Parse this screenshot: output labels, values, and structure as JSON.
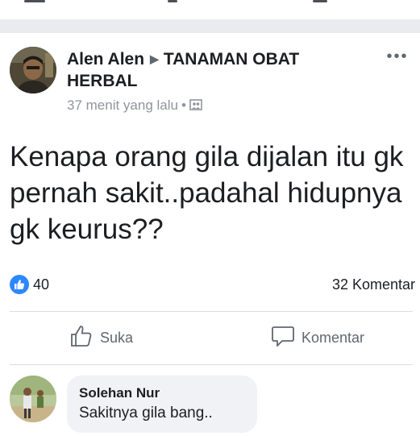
{
  "post": {
    "author": "Alen Alen",
    "group": "TANAMAN OBAT HERBAL",
    "time": "37 menit yang lalu",
    "separator": "•",
    "privacy_icon": "group-icon",
    "more_label": "•••",
    "text": "Kenapa orang gila dijalan itu gk pernah sakit..padahal hidupnya gk keurus??"
  },
  "reactions": {
    "like_count": "40",
    "comments_count": "32 Komentar",
    "like_color": "#2d88ff"
  },
  "actions": {
    "like_label": "Suka",
    "comment_label": "Komentar"
  },
  "comment": {
    "name": "Solehan Nur",
    "text": "Sakitnya gila bang.."
  }
}
